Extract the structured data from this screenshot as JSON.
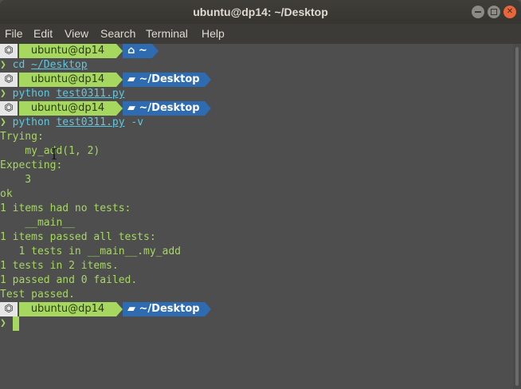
{
  "window": {
    "title": "ubuntu@dp14: ~/Desktop"
  },
  "menu": {
    "items": [
      "File",
      "Edit",
      "View",
      "Search",
      "Terminal",
      "Help"
    ]
  },
  "prompt": {
    "os_icon": "ubuntu-logo-icon",
    "user": "ubuntu@dp14",
    "chevron": "❯"
  },
  "terminal": {
    "p1": {
      "folder_icon": "home-icon",
      "dir": "~"
    },
    "c1": {
      "cmd": "cd",
      "arg": "~/Desktop",
      "rest": ""
    },
    "p2": {
      "folder_icon": "folder-icon",
      "dir": "~/Desktop"
    },
    "c2": {
      "cmd": "python",
      "arg": "test0311.py",
      "rest": ""
    },
    "p3": {
      "folder_icon": "folder-icon",
      "dir": "~/Desktop"
    },
    "c3": {
      "cmd": "python",
      "arg": "test0311.py",
      "rest": " -v"
    },
    "output": [
      "Trying:",
      "    my_add(1, 2)",
      "Expecting:",
      "    3",
      "ok",
      "1 items had no tests:",
      "    __main__",
      "1 items passed all tests:",
      "   1 tests in __main__.my_add",
      "1 tests in 2 items.",
      "1 passed and 0 failed.",
      "Test passed."
    ],
    "p4": {
      "folder_icon": "folder-icon",
      "dir": "~/Desktop"
    }
  },
  "colors": {
    "bg": "#4e4e4e",
    "green": "#a6d860",
    "cyan": "#5fc7df",
    "blue_segment": "#2e6bb0",
    "titlebar": "#3c3b37"
  }
}
